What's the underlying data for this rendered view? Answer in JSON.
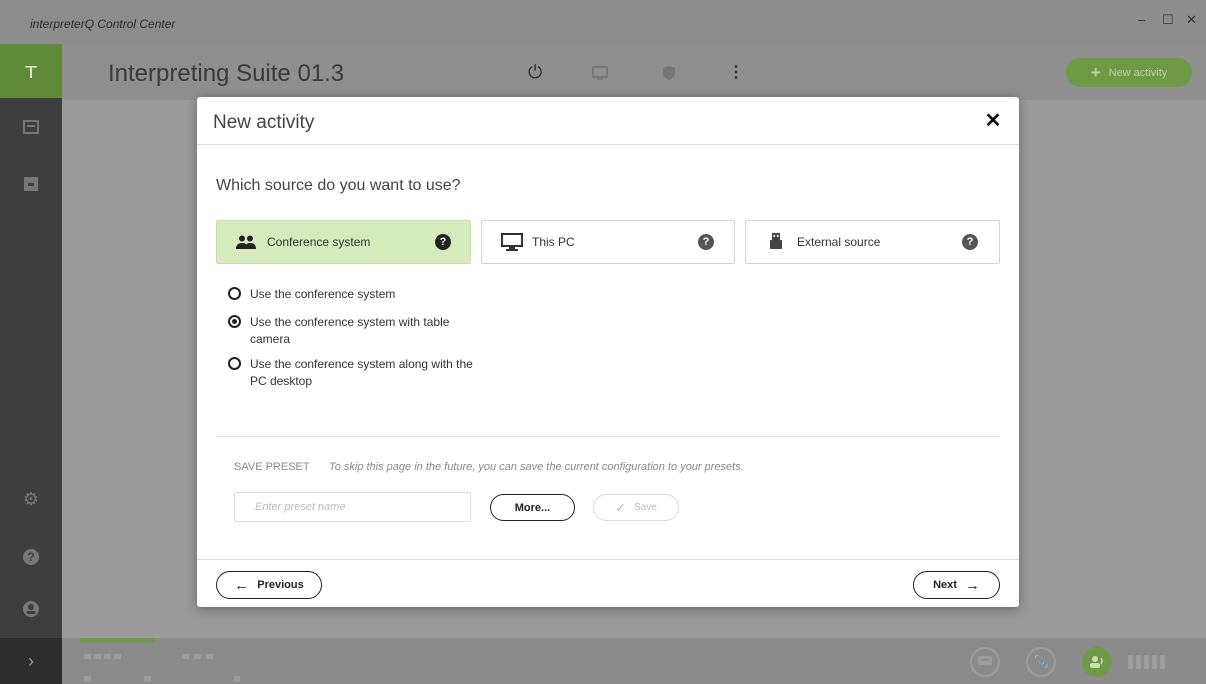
{
  "window": {
    "title": "interpreterQ Control Center",
    "controls": [
      "–",
      "☐",
      "✕"
    ]
  },
  "header": {
    "title": "Interpreting Suite 01.3",
    "new_activity_label": "New activity"
  },
  "modal": {
    "title": "New activity",
    "close": "✕",
    "question": "Which source do you want to use?",
    "sources": [
      {
        "label": "Conference system",
        "icon": "people-icon",
        "selected": true
      },
      {
        "label": "This PC",
        "icon": "monitor-icon",
        "selected": false
      },
      {
        "label": "External source",
        "icon": "usb-icon",
        "selected": false
      }
    ],
    "help_glyph": "?",
    "options": [
      {
        "label": "Use the conference system",
        "checked": false
      },
      {
        "label": "Use the conference system with table camera",
        "checked": true
      },
      {
        "label": "Use the conference system along with the PC desktop",
        "checked": false
      }
    ],
    "preset": {
      "label": "SAVE PRESET",
      "hint": "To skip this page in the future, you can save the current configuration to your presets.",
      "placeholder": "Enter preset name",
      "more_label": "More...",
      "save_label": "Save"
    },
    "footer": {
      "previous_label": "Previous",
      "next_label": "Next"
    }
  },
  "colors": {
    "accent": "#6e9a45",
    "selected_card": "#d6ebbc"
  }
}
